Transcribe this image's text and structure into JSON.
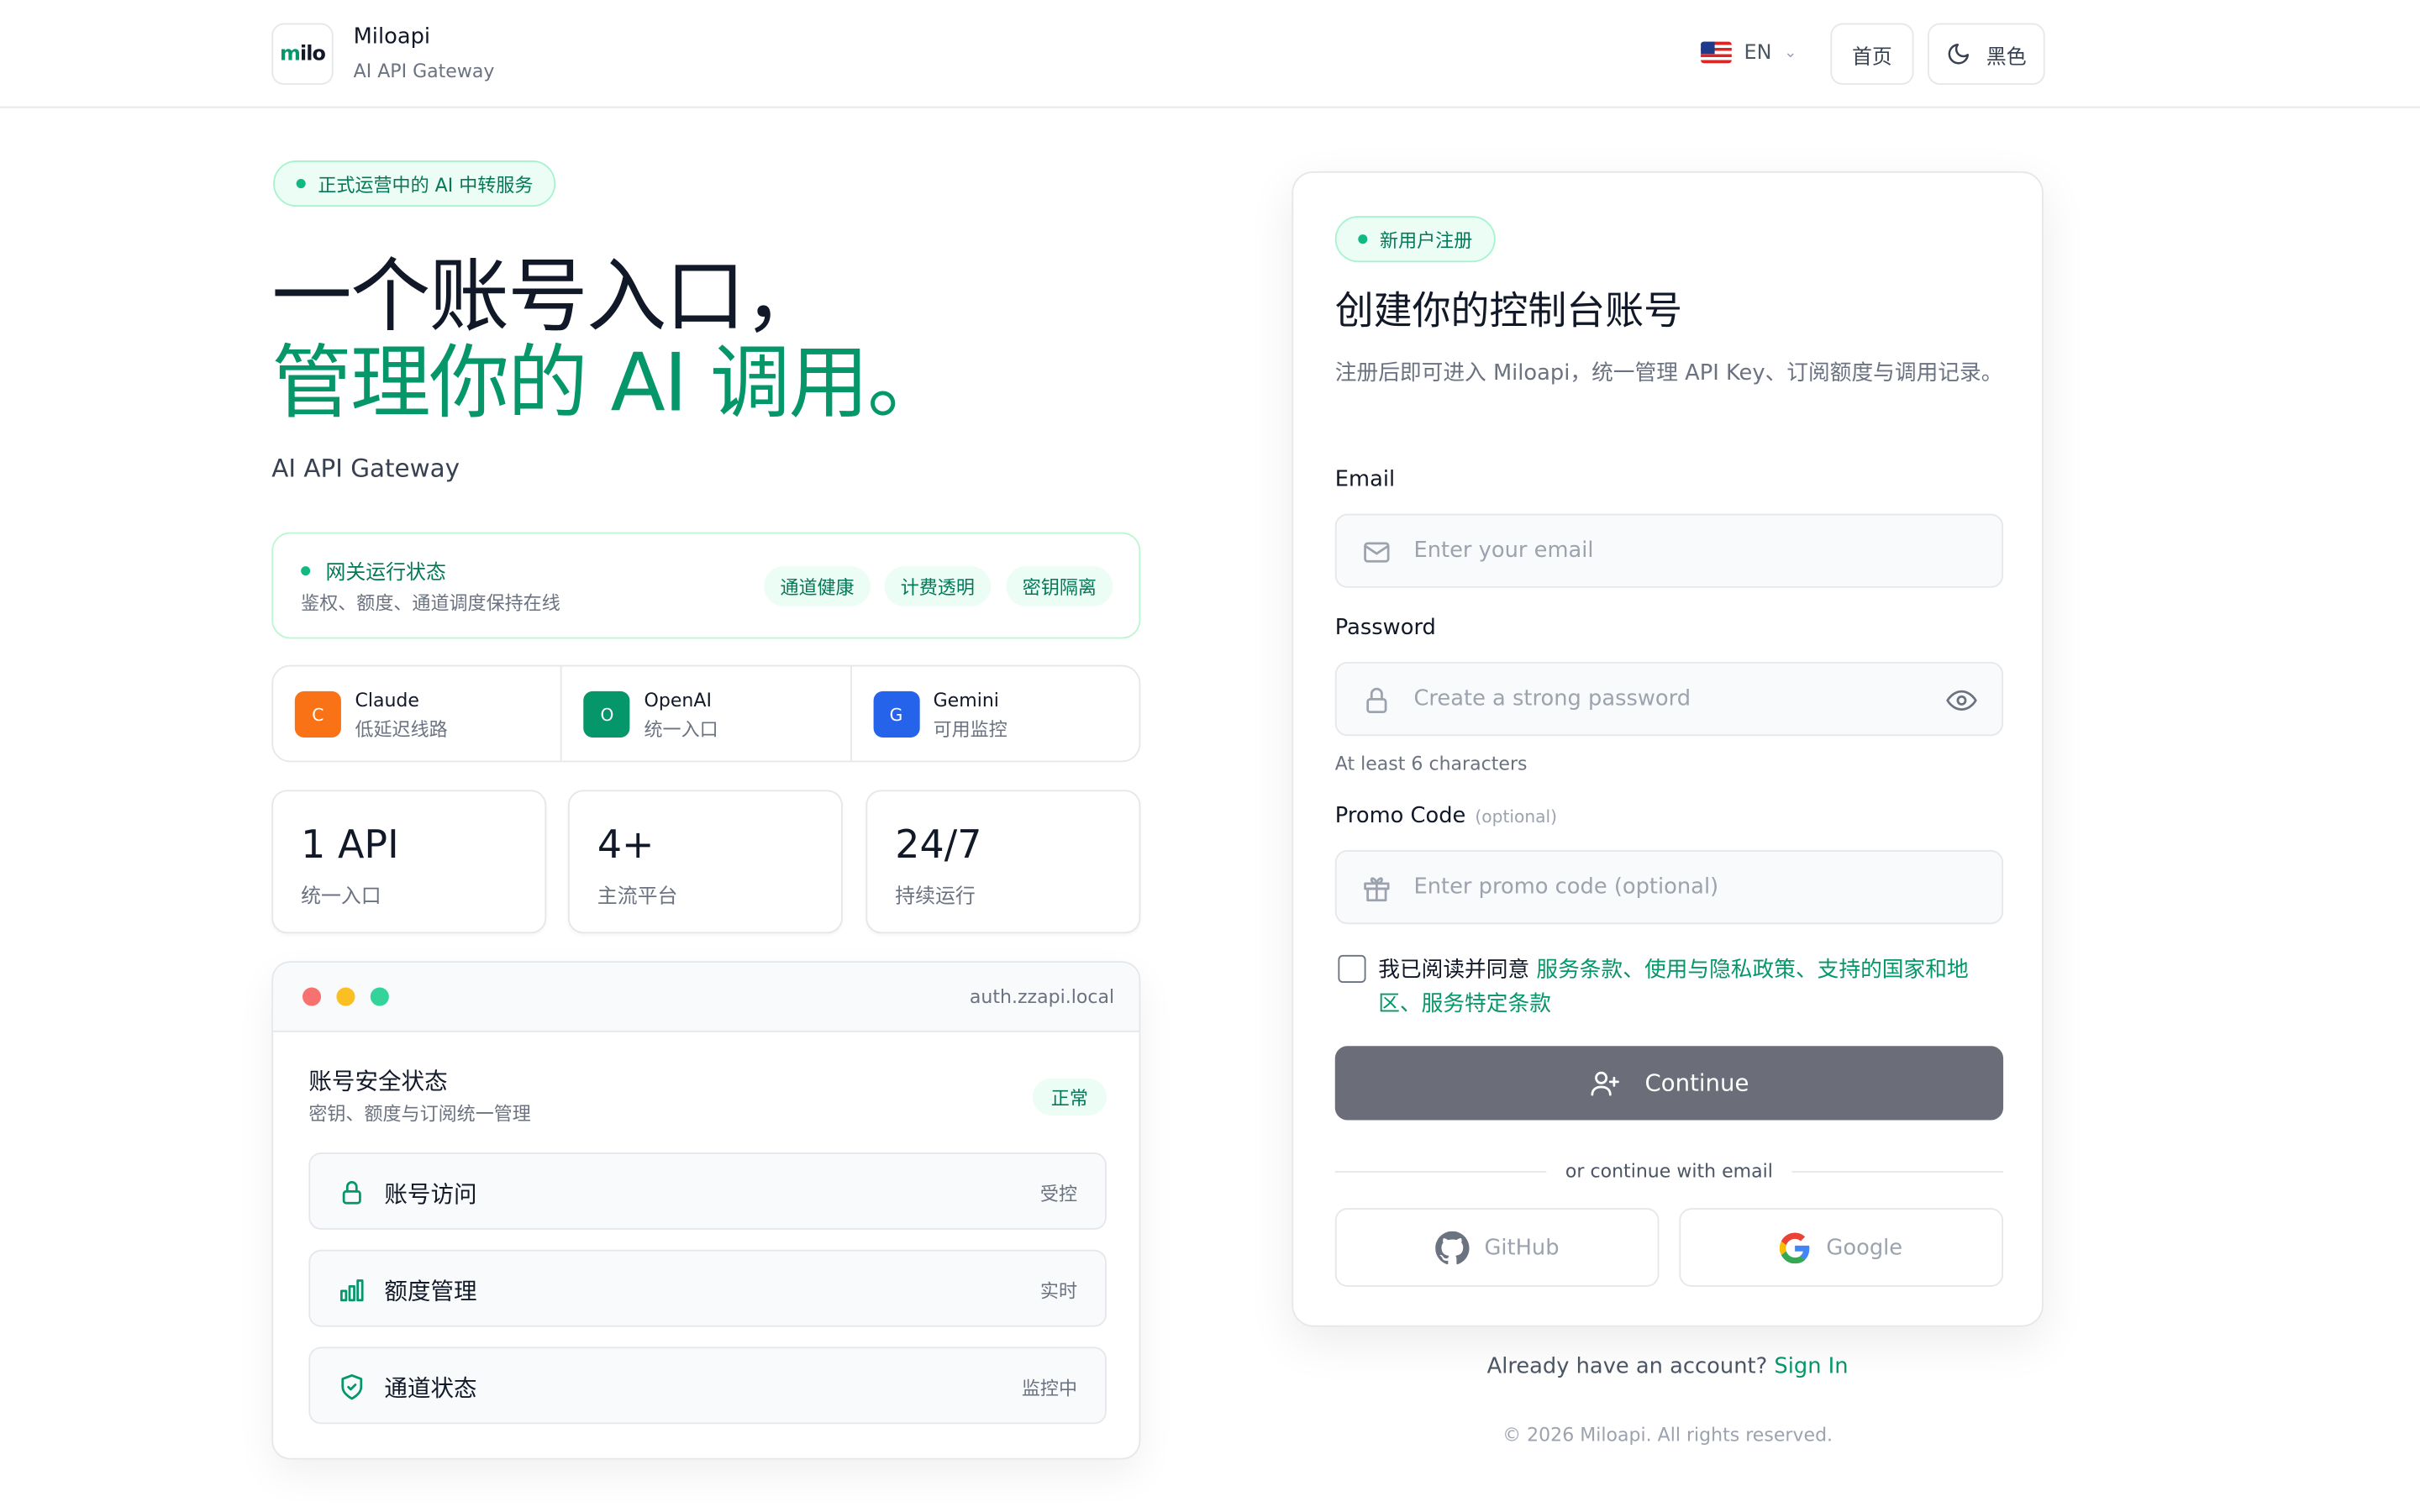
{
  "header": {
    "logo_prefix": "m",
    "logo_suffix": "ilo",
    "brand_name": "Miloapi",
    "brand_sub": "AI API Gateway",
    "lang": "EN",
    "home_label": "首页",
    "theme_label": "黑色"
  },
  "hero": {
    "pill": "正式运营中的 AI 中转服务",
    "title_line1": "一个账号入口，",
    "title_line2": "管理你的 AI 调用。",
    "subtitle": "AI API Gateway"
  },
  "status": {
    "title": "网关运行状态",
    "sub": "鉴权、额度、通道调度保持在线",
    "tags": [
      "通道健康",
      "计费透明",
      "密钥隔离"
    ]
  },
  "providers": [
    {
      "letter": "C",
      "name": "Claude",
      "sub": "低延迟线路",
      "color": "#f97316"
    },
    {
      "letter": "O",
      "name": "OpenAI",
      "sub": "统一入口",
      "color": "#059669"
    },
    {
      "letter": "G",
      "name": "Gemini",
      "sub": "可用监控",
      "color": "#2563eb"
    }
  ],
  "stats": [
    {
      "value": "1 API",
      "label": "统一入口"
    },
    {
      "value": "4+",
      "label": "主流平台"
    },
    {
      "value": "24/7",
      "label": "持续运行"
    }
  ],
  "security": {
    "host": "auth.zzapi.local",
    "title": "账号安全状态",
    "sub": "密钥、额度与订阅统一管理",
    "badge": "正常",
    "rows": [
      {
        "label": "账号访问",
        "value": "受控",
        "icon": "lock-icon"
      },
      {
        "label": "额度管理",
        "value": "实时",
        "icon": "bar-chart-icon"
      },
      {
        "label": "通道状态",
        "value": "监控中",
        "icon": "shield-check-icon"
      }
    ]
  },
  "register": {
    "pill": "新用户注册",
    "title": "创建你的控制台账号",
    "desc": "注册后即可进入 Miloapi，统一管理 API Key、订阅额度与调用记录。",
    "email_label": "Email",
    "email_placeholder": "Enter your email",
    "password_label": "Password",
    "password_placeholder": "Create a strong password",
    "password_hint": "At least 6 characters",
    "promo_label": "Promo Code",
    "promo_optional": "(optional)",
    "promo_placeholder": "Enter promo code (optional)",
    "agree_prefix": "我已阅读并同意 ",
    "agree_terms": "服务条款",
    "agree_sep1": "、",
    "agree_privacy": "使用与隐私政策",
    "agree_sep2": "、",
    "agree_regions": "支持的国家和地区",
    "agree_sep3": "、",
    "agree_specific": "服务特定条款",
    "continue_label": "Continue",
    "divider_text": "or continue with email",
    "github_label": "GitHub",
    "google_label": "Google"
  },
  "footer": {
    "signin_prefix": "Already have an account?",
    "signin_link": "Sign In",
    "copyright": "© 2026 Miloapi. All rights reserved."
  },
  "colors": {
    "accent": "#059669",
    "button": "#6b6e78"
  }
}
